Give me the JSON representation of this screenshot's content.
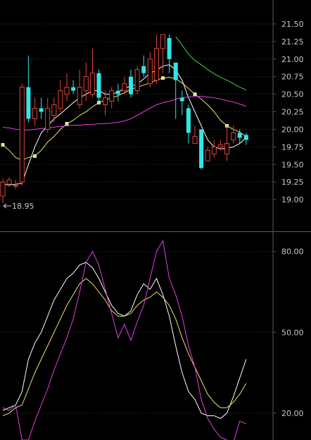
{
  "colors": {
    "background": "#000000",
    "axis": "#5a5a5a",
    "grid": "#3a3a3a",
    "text": "#c8c8c8",
    "candle_up": "#e0453a",
    "candle_down": "#33e6e6",
    "ma_white": "#ffffff",
    "ma_yellow": "#e8e86a",
    "ma_magenta": "#e040e0",
    "ma_green": "#3cd23c",
    "marker": "#e6e699"
  },
  "chart_data": [
    {
      "type": "candlestick",
      "ylim": [
        18.75,
        21.62
      ],
      "y_ticks": [
        "21.50",
        "21.25",
        "21.00",
        "20.75",
        "20.50",
        "20.25",
        "20.00",
        "19.75",
        "19.50",
        "19.25",
        "19.00"
      ],
      "grid": true,
      "annotations": [
        {
          "text": "18.95",
          "x": 0,
          "y": 18.95
        }
      ],
      "candles": [
        {
          "o": 19.05,
          "c": 19.25,
          "h": 19.3,
          "l": 18.95
        },
        {
          "o": 19.22,
          "c": 19.28,
          "h": 19.32,
          "l": 19.18
        },
        {
          "o": 19.2,
          "c": 19.2,
          "h": 19.28,
          "l": 19.15
        },
        {
          "o": 19.25,
          "c": 20.6,
          "h": 20.65,
          "l": 19.2
        },
        {
          "o": 20.6,
          "c": 20.15,
          "h": 21.05,
          "l": 20.1
        },
        {
          "o": 20.15,
          "c": 20.3,
          "h": 20.45,
          "l": 20.05
        },
        {
          "o": 20.3,
          "c": 20.25,
          "h": 20.45,
          "l": 20.15
        },
        {
          "o": 20.0,
          "c": 20.3,
          "h": 20.45,
          "l": 19.95
        },
        {
          "o": 20.2,
          "c": 20.35,
          "h": 20.45,
          "l": 20.1
        },
        {
          "o": 20.3,
          "c": 20.55,
          "h": 20.7,
          "l": 20.25
        },
        {
          "o": 20.5,
          "c": 20.6,
          "h": 20.8,
          "l": 20.4
        },
        {
          "o": 20.6,
          "c": 20.55,
          "h": 20.7,
          "l": 20.5
        },
        {
          "o": 20.35,
          "c": 20.6,
          "h": 20.85,
          "l": 20.3
        },
        {
          "o": 20.55,
          "c": 20.75,
          "h": 20.95,
          "l": 20.4
        },
        {
          "o": 20.5,
          "c": 20.8,
          "h": 21.15,
          "l": 20.45
        },
        {
          "o": 20.8,
          "c": 20.45,
          "h": 20.85,
          "l": 20.35
        },
        {
          "o": 20.35,
          "c": 20.45,
          "h": 20.55,
          "l": 20.2
        },
        {
          "o": 20.4,
          "c": 20.55,
          "h": 20.6,
          "l": 20.3
        },
        {
          "o": 20.55,
          "c": 20.5,
          "h": 20.65,
          "l": 20.4
        },
        {
          "o": 20.55,
          "c": 20.65,
          "h": 20.75,
          "l": 20.5
        },
        {
          "o": 20.75,
          "c": 20.5,
          "h": 20.85,
          "l": 20.45
        },
        {
          "o": 20.55,
          "c": 20.85,
          "h": 20.9,
          "l": 20.5
        },
        {
          "o": 20.9,
          "c": 20.8,
          "h": 21.05,
          "l": 20.75
        },
        {
          "o": 20.65,
          "c": 21.0,
          "h": 21.1,
          "l": 20.6
        },
        {
          "o": 20.7,
          "c": 21.15,
          "h": 21.35,
          "l": 20.65
        },
        {
          "o": 21.15,
          "c": 21.35,
          "h": 21.35,
          "l": 20.8
        },
        {
          "o": 21.3,
          "c": 21.0,
          "h": 21.35,
          "l": 20.8
        },
        {
          "o": 20.95,
          "c": 20.7,
          "h": 20.9,
          "l": 20.15
        },
        {
          "o": 20.45,
          "c": 20.4,
          "h": 20.55,
          "l": 20.2
        },
        {
          "o": 20.3,
          "c": 19.95,
          "h": 20.35,
          "l": 19.8
        },
        {
          "o": 19.8,
          "c": 19.9,
          "h": 20.05,
          "l": 19.8
        },
        {
          "o": 20.0,
          "c": 19.45,
          "h": 20.0,
          "l": 19.43
        },
        {
          "o": 19.55,
          "c": 19.7,
          "h": 19.75,
          "l": 19.55
        },
        {
          "o": 19.65,
          "c": 19.75,
          "h": 19.85,
          "l": 19.6
        },
        {
          "o": 19.75,
          "c": 19.78,
          "h": 19.85,
          "l": 19.7
        },
        {
          "o": 19.65,
          "c": 19.8,
          "h": 20.05,
          "l": 19.55
        },
        {
          "o": 19.85,
          "c": 19.95,
          "h": 20.05,
          "l": 19.8
        },
        {
          "o": 19.95,
          "c": 19.88,
          "h": 20.0,
          "l": 19.8
        },
        {
          "o": 19.92,
          "c": 19.85,
          "h": 19.95,
          "l": 19.78
        }
      ],
      "series": [
        {
          "color": "#ffffff",
          "x_start": 0,
          "values": [
            19.22,
            19.21,
            19.22,
            19.23,
            19.5,
            19.75,
            19.95,
            20.05,
            20.15,
            20.22,
            20.3,
            20.38,
            20.45,
            20.5,
            20.55,
            20.55,
            20.5,
            20.5,
            20.53,
            20.58,
            20.62,
            20.64,
            20.72,
            20.8,
            20.84,
            20.9,
            20.92,
            20.85,
            20.7,
            20.45,
            20.25,
            20.05,
            19.85,
            19.75,
            19.72,
            19.73,
            19.75,
            19.8,
            19.88
          ]
        },
        {
          "color": "#e8e86a",
          "x_start": 0,
          "markers": true,
          "values": [
            19.78,
            19.7,
            19.6,
            19.56,
            19.6,
            19.62,
            19.7,
            19.82,
            19.9,
            20.0,
            20.08,
            20.13,
            20.2,
            20.25,
            20.32,
            20.38,
            20.42,
            20.45,
            20.48,
            20.52,
            20.57,
            20.6,
            20.63,
            20.66,
            20.7,
            20.73,
            20.74,
            20.72,
            20.66,
            20.58,
            20.5,
            20.43,
            20.35,
            20.25,
            20.13,
            20.05,
            20.0,
            19.96,
            19.9
          ]
        },
        {
          "color": "#e040e0",
          "x_start": 0,
          "values": [
            20.03,
            20.02,
            20.0,
            19.99,
            19.99,
            20.0,
            20.01,
            20.02,
            20.03,
            20.04,
            20.05,
            20.06,
            20.06,
            20.07,
            20.07,
            20.08,
            20.08,
            20.09,
            20.1,
            20.12,
            20.15,
            20.2,
            20.25,
            20.3,
            20.35,
            20.38,
            20.4,
            20.43,
            20.45,
            20.46,
            20.47,
            20.47,
            20.46,
            20.45,
            20.43,
            20.41,
            20.39,
            20.36,
            20.33
          ]
        },
        {
          "color": "#3cd23c",
          "x_start": 27,
          "values": [
            21.32,
            21.2,
            21.07,
            20.98,
            20.92,
            20.85,
            20.79,
            20.74,
            20.7,
            20.65,
            20.6,
            20.56
          ]
        }
      ]
    },
    {
      "type": "line",
      "ylim": [
        10,
        87
      ],
      "y_ticks": [
        "80.00",
        "50.00",
        "20.00"
      ],
      "grid": true,
      "series": [
        {
          "color": "#ffffff",
          "values": [
            21,
            22,
            23,
            28,
            40,
            46,
            50,
            56,
            62,
            66,
            70,
            72,
            75,
            76,
            74,
            70,
            65,
            60,
            57,
            56,
            58,
            64,
            68,
            66,
            70,
            64,
            56,
            45,
            35,
            28,
            25,
            20,
            19,
            19,
            18,
            20,
            26,
            33,
            40
          ]
        },
        {
          "color": "#e8e86a",
          "values": [
            19,
            20,
            22,
            23,
            29,
            35,
            40,
            45,
            50,
            55,
            60,
            64,
            68,
            70,
            68,
            65,
            62,
            58,
            56,
            56,
            57,
            60,
            62,
            63,
            65,
            63,
            60,
            55,
            48,
            42,
            37,
            32,
            27,
            24,
            22,
            22,
            24,
            27,
            31
          ]
        },
        {
          "color": "#e040e0",
          "values": [
            22,
            21,
            23,
            10,
            10,
            17,
            23,
            29,
            36,
            42,
            48,
            55,
            65,
            76,
            80,
            75,
            66,
            57,
            48,
            53,
            47,
            54,
            60,
            70,
            80,
            84,
            70,
            64,
            56,
            45,
            37,
            25,
            18,
            14,
            11,
            10,
            9,
            17,
            16
          ]
        }
      ]
    }
  ]
}
